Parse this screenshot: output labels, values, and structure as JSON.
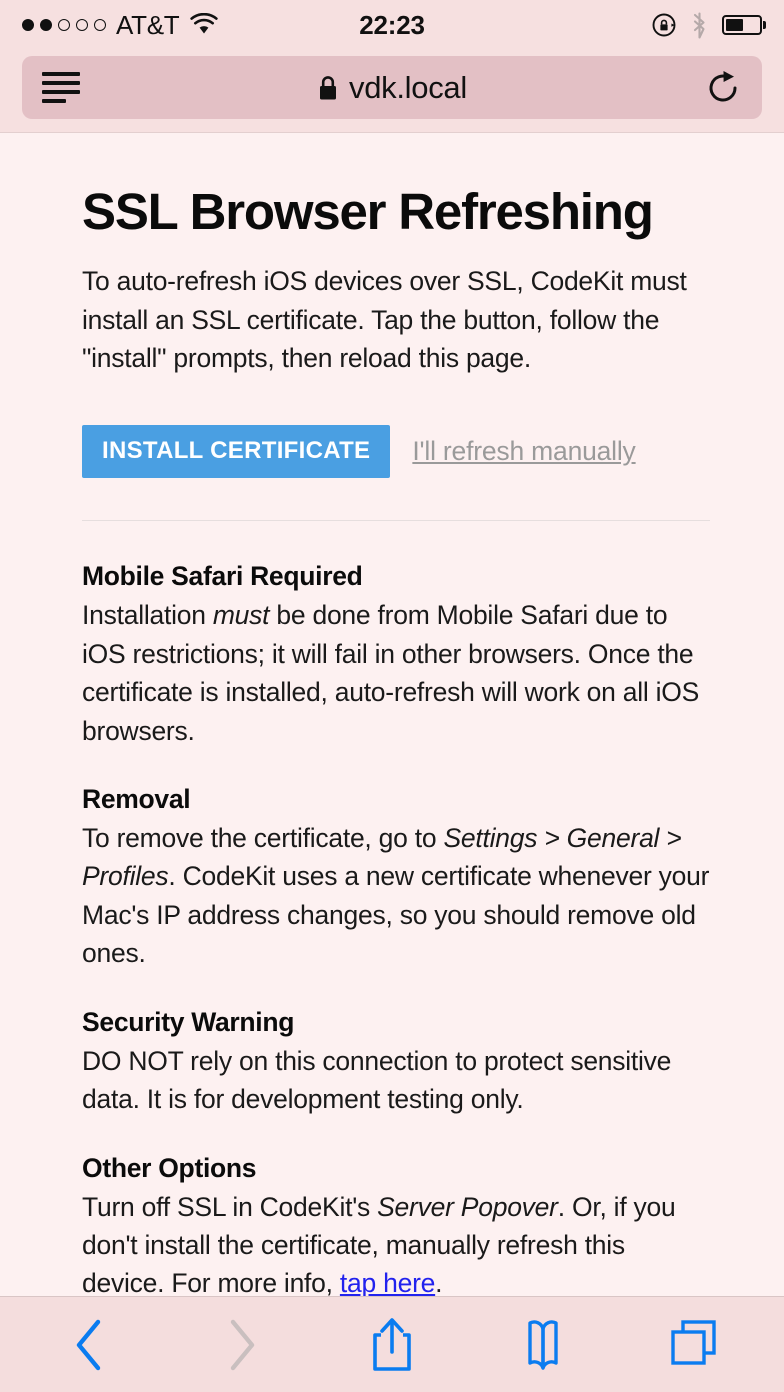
{
  "status_bar": {
    "carrier": "AT&T",
    "signal_dots_filled": 2,
    "signal_dots_total": 5,
    "wifi_icon": "wifi-icon",
    "time": "22:23",
    "rotation_lock_icon": "rotation-lock-icon",
    "bluetooth_icon": "bluetooth-icon",
    "battery_icon": "battery-icon",
    "battery_level_percent": 55
  },
  "browser": {
    "reader_icon": "reader-view-icon",
    "lock_icon": "lock-icon",
    "url": "vdk.local",
    "reload_icon": "reload-icon"
  },
  "page": {
    "title": "SSL Browser Refreshing",
    "intro": "To auto-refresh iOS devices over SSL, CodeKit must install an SSL certificate. Tap the button, follow the \"install\" prompts, then reload this page.",
    "install_button_label": "INSTALL CERTIFICATE",
    "manual_refresh_link": "I'll refresh manually",
    "sections": [
      {
        "heading": "Mobile Safari Required",
        "body_parts": [
          {
            "text": "Installation ",
            "style": "normal"
          },
          {
            "text": "must",
            "style": "italic"
          },
          {
            "text": " be done from Mobile Safari due to iOS restrictions; it will fail in other browsers. Once the certificate is installed, auto-refresh will work on all iOS browsers.",
            "style": "normal"
          }
        ]
      },
      {
        "heading": "Removal",
        "body_parts": [
          {
            "text": "To remove the certificate, go to ",
            "style": "normal"
          },
          {
            "text": "Settings > General > Profiles",
            "style": "italic"
          },
          {
            "text": ". CodeKit uses a new certificate whenever your Mac's IP address changes, so you should remove old ones.",
            "style": "normal"
          }
        ]
      },
      {
        "heading": "Security Warning",
        "body_parts": [
          {
            "text": "DO NOT rely on this connection to protect sensitive data. It is for development testing only.",
            "style": "normal"
          }
        ]
      },
      {
        "heading": "Other Options",
        "body_parts": [
          {
            "text": "Turn off SSL in CodeKit's ",
            "style": "normal"
          },
          {
            "text": "Server Popover",
            "style": "italic"
          },
          {
            "text": ". Or, if you don't install the certificate, manually refresh this device. For more info, ",
            "style": "normal"
          },
          {
            "text": "tap here",
            "style": "link"
          },
          {
            "text": ".",
            "style": "normal"
          }
        ]
      }
    ]
  },
  "toolbar": {
    "back_icon": "back-chevron-icon",
    "forward_icon": "forward-chevron-icon",
    "share_icon": "share-icon",
    "bookmarks_icon": "bookmarks-book-icon",
    "tabs_icon": "tabs-icon",
    "back_enabled": true,
    "forward_enabled": false
  },
  "colors": {
    "accent_blue": "#4a9fe2",
    "toolbar_icon_blue": "#0a7cf0",
    "disabled_gray": "#c9bfbf",
    "link_blue": "#2222ee",
    "muted_link_gray": "#9a9a9a",
    "page_background": "#fdf1f1",
    "chrome_background": "#f6e0e0",
    "url_pill_background": "#e3c0c5",
    "bottom_toolbar_background": "#f4dddd"
  }
}
